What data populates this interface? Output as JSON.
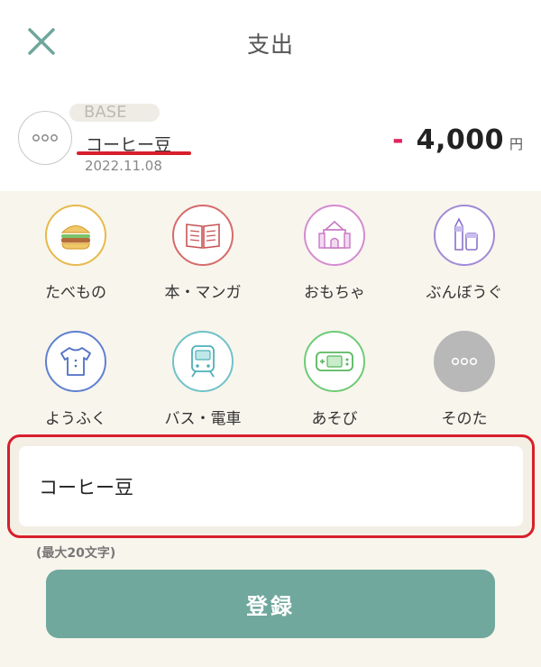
{
  "header": {
    "title": "支出"
  },
  "transaction": {
    "store": "BASE",
    "item_name": "コーヒー豆",
    "date": "2022.11.08",
    "sign": "-",
    "amount": "4,000",
    "unit": "円"
  },
  "categories": [
    {
      "label": "たべもの",
      "icon": "hamburger-icon",
      "color": "#e8b94a"
    },
    {
      "label": "本・マンガ",
      "icon": "book-icon",
      "color": "#d66a6a"
    },
    {
      "label": "おもちゃ",
      "icon": "toy-castle-icon",
      "color": "#d48bd1"
    },
    {
      "label": "ぶんぼうぐ",
      "icon": "stationery-icon",
      "color": "#a08ad6"
    },
    {
      "label": "ようふく",
      "icon": "shirt-icon",
      "color": "#5e7fd1"
    },
    {
      "label": "バス・電車",
      "icon": "train-icon",
      "color": "#6fc2c8"
    },
    {
      "label": "あそび",
      "icon": "game-console-icon",
      "color": "#6ecb75"
    },
    {
      "label": "そのた",
      "icon": "more-icon",
      "color": "#b8b8b8"
    }
  ],
  "input": {
    "value": "コーヒー豆",
    "hint": "(最大20文字)"
  },
  "submit": {
    "label": "登録"
  }
}
